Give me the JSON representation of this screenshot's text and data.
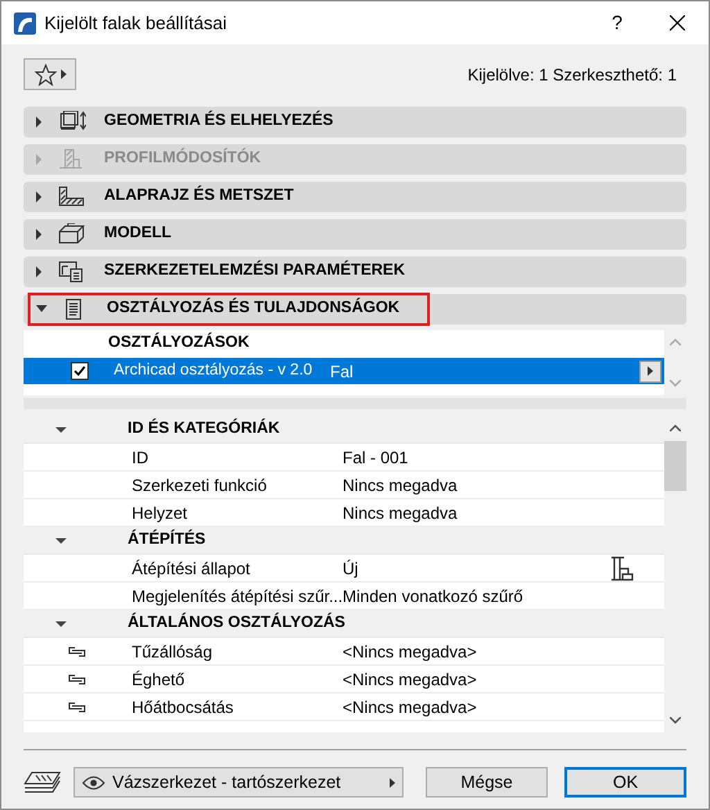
{
  "window": {
    "title": "Kijelölt falak beállításai",
    "help": "?"
  },
  "selection_info": "Kijelölve: 1 Szerkeszthető: 1",
  "sections": [
    {
      "kind": "geometry",
      "label": "GEOMETRIA ÉS ELHELYEZÉS",
      "expanded": false,
      "disabled": false,
      "highlighted": false
    },
    {
      "kind": "profile",
      "label": "PROFILMÓDOSÍTÓK",
      "expanded": false,
      "disabled": true,
      "highlighted": false
    },
    {
      "kind": "plan",
      "label": "ALAPRAJZ ÉS METSZET",
      "expanded": false,
      "disabled": false,
      "highlighted": false
    },
    {
      "kind": "model",
      "label": "MODELL",
      "expanded": false,
      "disabled": false,
      "highlighted": false
    },
    {
      "kind": "structural",
      "label": "SZERKEZETELEMZÉSI PARAMÉTEREK",
      "expanded": false,
      "disabled": false,
      "highlighted": false
    },
    {
      "kind": "classification",
      "label": "OSZTÁLYOZÁS ÉS TULAJDONSÁGOK",
      "expanded": true,
      "disabled": false,
      "highlighted": true
    }
  ],
  "classifications": {
    "heading": "OSZTÁLYOZÁSOK",
    "rows": [
      {
        "system": "Archicad osztályozás - v 2.0",
        "value": "Fal",
        "checked": true,
        "selected": true
      }
    ]
  },
  "property_groups": [
    {
      "label": "ID ÉS KATEGÓRIÁK",
      "expanded": true,
      "children": [
        {
          "name": "ID",
          "value": "Fal - 001",
          "linked": false,
          "filter_icon": false
        },
        {
          "name": "Szerkezeti funkció",
          "value": "Nincs megadva",
          "linked": false,
          "filter_icon": false
        },
        {
          "name": "Helyzet",
          "value": "Nincs megadva",
          "linked": false,
          "filter_icon": false
        }
      ]
    },
    {
      "label": "ÁTÉPÍTÉS",
      "expanded": true,
      "children": [
        {
          "name": "Átépítési állapot",
          "value": "Új",
          "linked": false,
          "filter_icon": true
        },
        {
          "name": "Megjelenítés átépítési szűr...",
          "value": "Minden vonatkozó szűrő",
          "linked": false,
          "filter_icon": false
        }
      ]
    },
    {
      "label": "ÁLTALÁNOS OSZTÁLYOZÁS",
      "expanded": true,
      "children": [
        {
          "name": "Tűzállóság",
          "value": "<Nincs megadva>",
          "linked": true,
          "filter_icon": false
        },
        {
          "name": "Éghető",
          "value": "<Nincs megadva>",
          "linked": true,
          "filter_icon": false
        },
        {
          "name": "Hőátbocsátás",
          "value": "<Nincs megadva>",
          "linked": true,
          "filter_icon": false
        }
      ]
    }
  ],
  "footer": {
    "layer": "Vázszerkezet - tartószerkezet",
    "buttons": [
      {
        "label": "Mégse",
        "default": false
      },
      {
        "label": "OK",
        "default": true
      }
    ]
  }
}
